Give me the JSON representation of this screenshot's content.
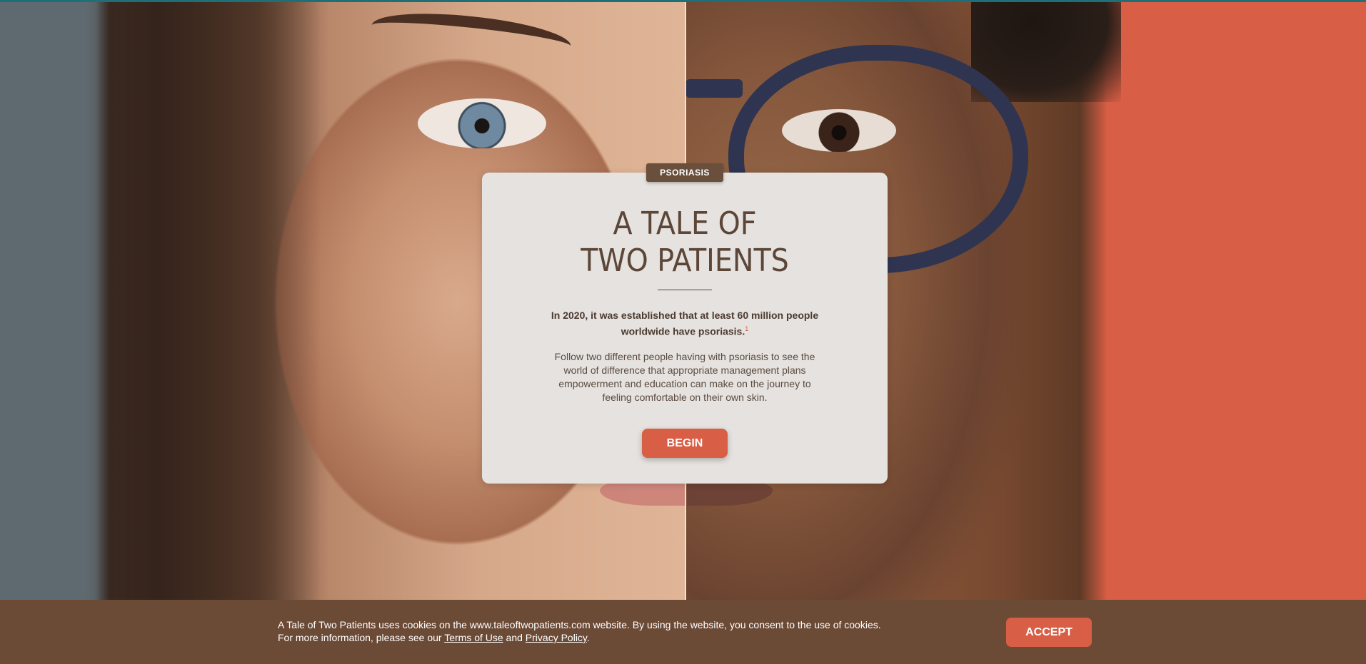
{
  "hero": {
    "badge": "PSORIASIS",
    "title_line1": "A TALE OF",
    "title_line2": "TWO PATIENTS",
    "lead": "In 2020, it was established that at least 60 million people worldwide have psoriasis.",
    "lead_footnote": "1",
    "body": "Follow two different people having with psoriasis to see the world of difference that appropriate management plans empowerment and education can make on the journey to feeling comfortable on their own skin.",
    "begin_label": "BEGIN"
  },
  "cookie": {
    "line1": "A Tale of Two Patients uses cookies on the www.taleoftwopatients.com website. By using the website, you consent to the use of cookies.",
    "line2_prefix": "For more information, please see our ",
    "terms_label": "Terms of Use",
    "and_text": " and ",
    "privacy_label": "Privacy Policy",
    "line2_suffix": ".",
    "accept_label": "ACCEPT"
  },
  "colors": {
    "accent": "#d85e45",
    "brown": "#6b4a36",
    "card": "#e5e2df",
    "topbar": "#1f6f78"
  }
}
